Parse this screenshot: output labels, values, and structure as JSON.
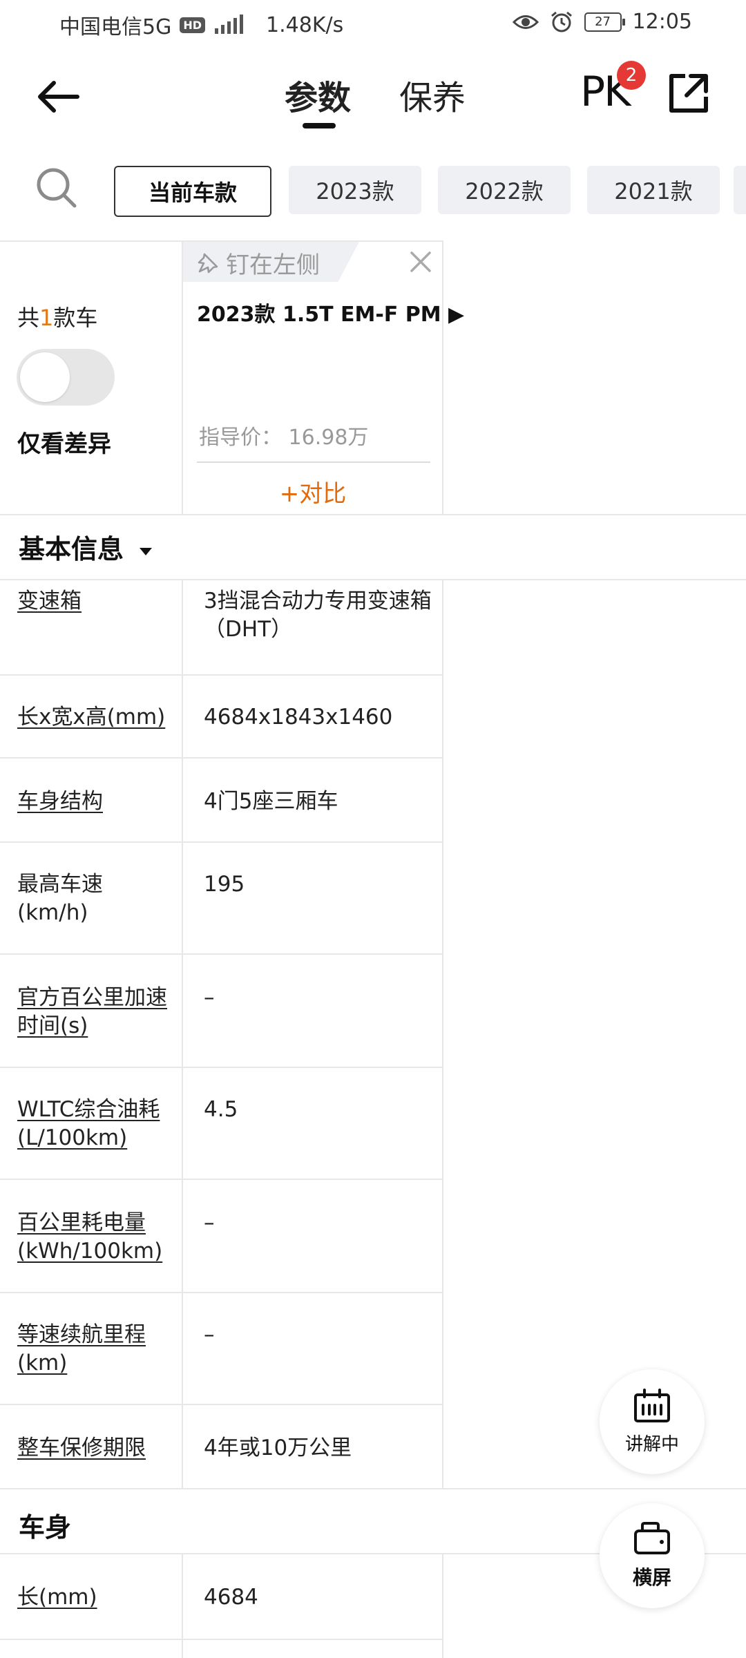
{
  "status_bar": {
    "carrier": "中国电信5G",
    "hd": "HD",
    "speed": "1.48K/s",
    "battery": "27",
    "time": "12:05"
  },
  "header": {
    "tabs": [
      {
        "label": "参数",
        "active": true
      },
      {
        "label": "保养",
        "active": false
      }
    ],
    "pk_label": "PK",
    "pk_badge": "2"
  },
  "year_filter": {
    "chips": [
      "当前车款",
      "2023款",
      "2022款",
      "2021款"
    ]
  },
  "car_card": {
    "pin_label": "钉在左侧",
    "count_prefix": "共",
    "count": "1",
    "count_suffix": "款车",
    "diff_only_label": "仅看差异",
    "model_name": "2023款 1.5T EM-F PM ▶",
    "price": "指导价： 16.98万",
    "compare_label": "+对比"
  },
  "sections": [
    {
      "title": "基本信息"
    },
    {
      "title": "车身"
    }
  ],
  "params": [
    {
      "label": "变速箱",
      "value": "3挡混合动力专用变速箱（DHT）"
    },
    {
      "label": "长x宽x高(mm)",
      "value": "4684x1843x1460"
    },
    {
      "label": "车身结构",
      "value": "4门5座三厢车"
    },
    {
      "label": "最高车速(km/h)",
      "value": "195"
    },
    {
      "label": "官方百公里加速时间(s)",
      "value": "–"
    },
    {
      "label": "WLTC综合油耗(L/100km)",
      "value": "4.5"
    },
    {
      "label": "百公里耗电量(kWh/100km)",
      "value": "–"
    },
    {
      "label": "等速续航里程(km)",
      "value": "–"
    },
    {
      "label": "整车保修期限",
      "value": "4年或10万公里"
    }
  ],
  "body_params": [
    {
      "label": "长(mm)",
      "value": "4684"
    }
  ],
  "fabs": {
    "explain_label": "讲解中",
    "landscape_label": "横屏"
  }
}
